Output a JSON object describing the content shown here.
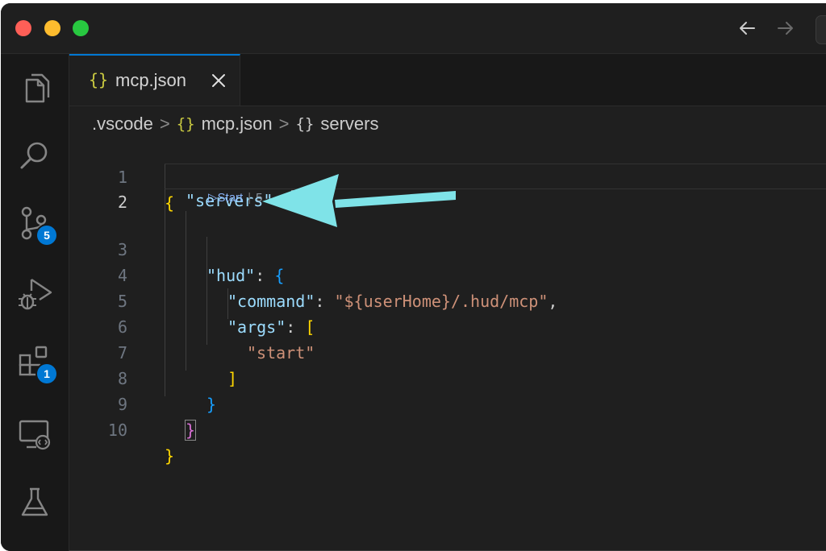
{
  "window": {
    "traffic_lights": [
      "close",
      "minimize",
      "zoom"
    ],
    "nav": {
      "back_icon": "arrow-left-icon",
      "forward_icon": "arrow-right-icon"
    }
  },
  "activitybar": {
    "items": [
      {
        "name": "explorer",
        "icon": "files-icon"
      },
      {
        "name": "search",
        "icon": "search-icon"
      },
      {
        "name": "source-control",
        "icon": "source-control-icon",
        "badge": "5"
      },
      {
        "name": "run-and-debug",
        "icon": "run-debug-icon"
      },
      {
        "name": "extensions",
        "icon": "extensions-icon",
        "badge": "1"
      },
      {
        "name": "remote-explorer",
        "icon": "remote-explorer-icon"
      },
      {
        "name": "testing",
        "icon": "flask-icon"
      }
    ]
  },
  "tab": {
    "braces": "{}",
    "label": "mcp.json"
  },
  "breadcrumb": {
    "folder": ".vscode",
    "file_braces": "{}",
    "file": "mcp.json",
    "symbol_braces": "{}",
    "symbol": "servers",
    "separator": ">"
  },
  "codelens": {
    "start": "▷Start",
    "separator": "|",
    "count": "5"
  },
  "editor": {
    "lines": [
      {
        "num": "1"
      },
      {
        "num": "2"
      },
      {
        "num": "3"
      },
      {
        "num": "4"
      },
      {
        "num": "5"
      },
      {
        "num": "6"
      },
      {
        "num": "7"
      },
      {
        "num": "8"
      },
      {
        "num": "9"
      },
      {
        "num": "10"
      }
    ],
    "tokens": {
      "open_root": "{",
      "servers_key": "\"servers\"",
      "colon": ":",
      "servers_open": "{",
      "hud_key": "\"hud\"",
      "hud_open": "{",
      "command_key": "\"command\"",
      "command_value": "\"${userHome}/.hud/mcp\"",
      "comma": ",",
      "args_key": "\"args\"",
      "args_open": "[",
      "start_value": "\"start\"",
      "args_close": "]",
      "hud_close": "}",
      "servers_close": "}",
      "close_root": "}"
    }
  },
  "colors": {
    "background": "#1f1f1f",
    "accent": "#0078d4",
    "annotation_arrow": "#7fe3e8"
  }
}
